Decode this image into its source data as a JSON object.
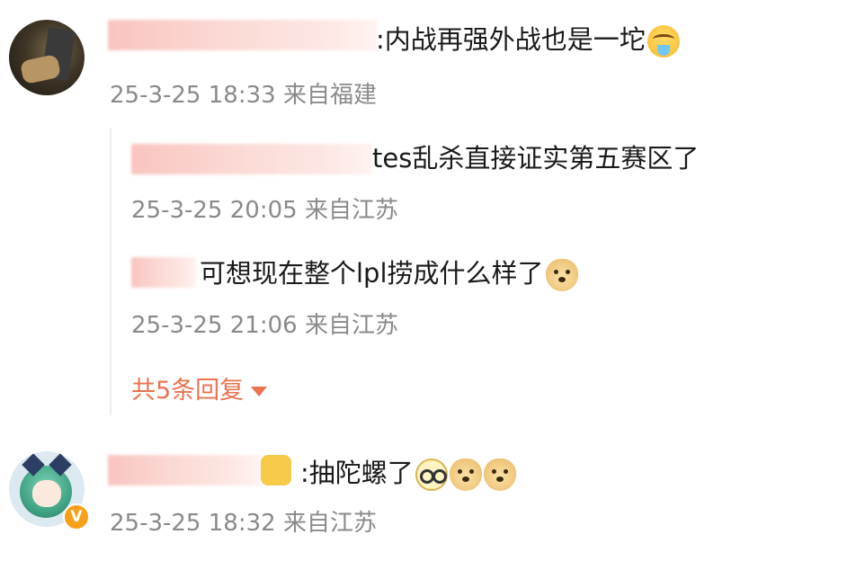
{
  "comments": [
    {
      "text": ":内战再强外战也是一坨",
      "emoji": "drooling-face",
      "time": "25-3-25 18:33",
      "location": "来自福建",
      "replies": [
        {
          "text": "tes乱杀直接证实第五赛区了",
          "time": "25-3-25 20:05",
          "location": "来自江苏"
        },
        {
          "text": "可想现在整个lpl捞成什么样了",
          "emoji": "doge",
          "time": "25-3-25 21:06",
          "location": "来自江苏"
        }
      ],
      "more_replies": "共5条回复"
    },
    {
      "text": ":抽陀螺了",
      "emojis": [
        "glasses",
        "doge",
        "doge"
      ],
      "time": "25-3-25 18:32",
      "location": "来自江苏",
      "verified_badge": "V"
    }
  ],
  "colors": {
    "accent": "#eb7350",
    "meta_text": "#8a8a8a",
    "verified": "#f6a01a"
  }
}
